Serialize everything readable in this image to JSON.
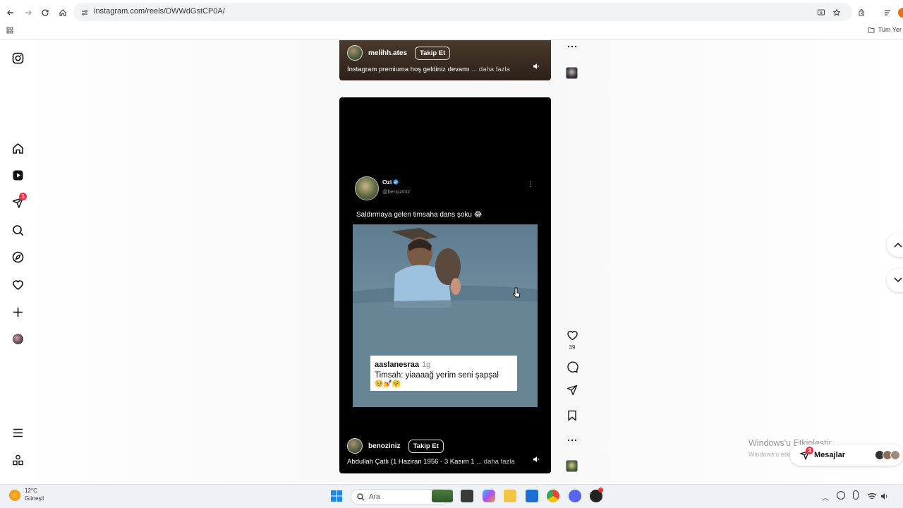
{
  "browser": {
    "url": "instagram.com/reels/DWWdGstCP0A/",
    "bookmarks_label": "Tüm Yer"
  },
  "sidebar": {
    "notifications_badge": "3"
  },
  "reel_top": {
    "username": "melihh.ates",
    "follow_label": "Takip Et",
    "caption": "İnstagram premiuma hoş geldiniz devamı",
    "more": "... daha fazla"
  },
  "reel_main": {
    "tweet_name": "Ozi",
    "tweet_handle": "@benoziniz",
    "tweet_text": "Saldırmaya gelen timsaha dans şoku 😂",
    "comment_user": "aaslanesraa",
    "comment_time": "1g",
    "comment_text": "Timsah: yiaaaağ yerim seni şapşal",
    "comment_emojis": "🥺💅🤗",
    "username": "benoziniz",
    "follow_label": "Takip Et",
    "caption": "Abdullah Çatlı (1 Haziran 1956 - 3 Kasım 1",
    "more": "... daha fazla"
  },
  "actions": {
    "like_count": "39"
  },
  "windows_activation": {
    "title": "Windows'u Etkinleştir",
    "subtitle": "Windows'u etkinleştirmek için Ayarlar'a gidin."
  },
  "messages": {
    "label": "Mesajlar",
    "badge": "3"
  },
  "taskbar": {
    "weather_temp": "12°C",
    "weather_cond": "Güneşli",
    "search_placeholder": "Ara"
  },
  "colors": {
    "badge": "#ff3040",
    "reel_bg": "#000000",
    "verified": "#3897f0"
  }
}
